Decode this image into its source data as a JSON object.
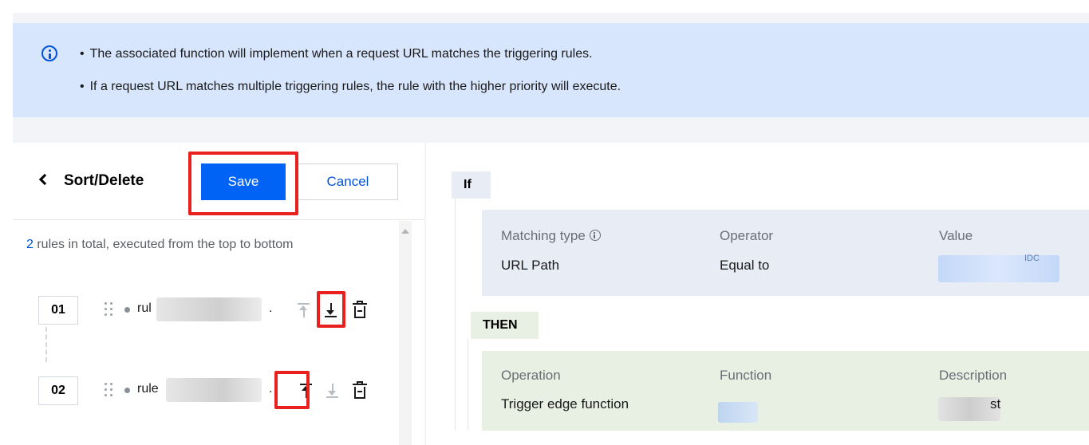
{
  "notice": {
    "items": [
      "The associated function will implement when a request URL matches the triggering rules.",
      "If a request URL matches multiple triggering rules, the rule with the higher priority will execute."
    ]
  },
  "left_panel": {
    "title": "Sort/Delete",
    "save_label": "Save",
    "cancel_label": "Cancel",
    "summary_count": "2",
    "summary_text": " rules in total, executed from the top to bottom",
    "rules": [
      {
        "number": "01",
        "name": "rul",
        "suffix": "."
      },
      {
        "number": "02",
        "name": "rule",
        "suffix": "."
      }
    ]
  },
  "right_panel": {
    "if_label": "If",
    "then_label": "THEN",
    "condition": {
      "col1_label": "Matching type",
      "col1_value": "URL Path",
      "col2_label": "Operator",
      "col2_value": "Equal to",
      "col3_label": "Value",
      "col3_value": "IDC"
    },
    "action": {
      "col1_label": "Operation",
      "col1_value": "Trigger edge function",
      "col2_label": "Function",
      "col3_label": "Description",
      "col3_value": "st"
    }
  },
  "colors": {
    "primary": "#0063f5",
    "notice_bg": "#d7e5fd",
    "highlight": "#e8201e",
    "if_bg": "#e8edf5",
    "then_bg": "#e7f0e3"
  }
}
